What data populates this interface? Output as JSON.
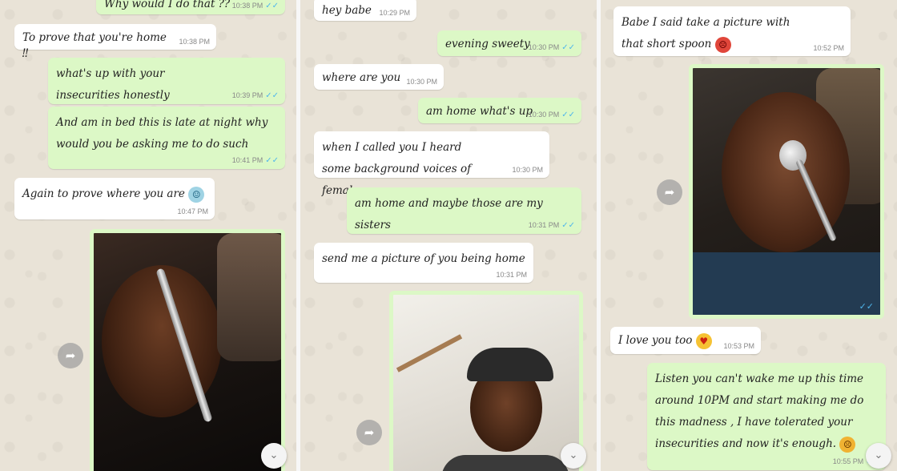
{
  "panels": [
    {
      "messages": [
        {
          "dir": "out",
          "text": "Why would I do that ??",
          "time": "10:38 PM",
          "ticks": "✓✓"
        },
        {
          "dir": "in",
          "text": "To prove that you're home ‼",
          "time": "10:38 PM"
        },
        {
          "dir": "out",
          "text": "what's up with your insecurities honestly",
          "time": "10:39 PM",
          "ticks": "✓✓"
        },
        {
          "dir": "out",
          "text": "And am in bed this is late at night why would you be asking me to do such",
          "time": "10:41 PM",
          "ticks": "✓✓"
        },
        {
          "dir": "in",
          "text": "Again to prove where you are",
          "time": "10:47 PM",
          "emoji": "shrug"
        }
      ]
    },
    {
      "messages": [
        {
          "dir": "in",
          "text": "hey babe",
          "time": "10:29 PM"
        },
        {
          "dir": "out",
          "text": "evening sweety",
          "time": "10:30 PM",
          "ticks": "✓✓"
        },
        {
          "dir": "in",
          "text": "where are you",
          "time": "10:30 PM"
        },
        {
          "dir": "out",
          "text": "am home what's up",
          "time": "10:30 PM",
          "ticks": "✓✓"
        },
        {
          "dir": "in",
          "text": "when I called you I heard some background voices of females",
          "time": "10:30 PM"
        },
        {
          "dir": "out",
          "text": "am home and maybe those are my sisters",
          "time": "10:31 PM",
          "ticks": "✓✓"
        },
        {
          "dir": "in",
          "text": "send me a picture of you being home",
          "time": "10:31 PM"
        }
      ]
    },
    {
      "messages": [
        {
          "dir": "in",
          "text": "Babe I said take a picture with that short spoon",
          "time": "10:52 PM",
          "emoji": "angry"
        },
        {
          "dir": "in",
          "text": "I love you too",
          "time": "10:53 PM",
          "emoji": "heart"
        },
        {
          "dir": "out",
          "text": "Listen you can't wake me up this time around 10PM and start making me do this madness , I have tolerated your insecurities and now it's enough.",
          "time": "10:55 PM",
          "ticks": "✓✓",
          "emoji": "frown"
        }
      ],
      "photo_ticks": "✓✓"
    }
  ],
  "icons": {
    "share": "share-arrow-icon",
    "scroll": "chevron-double-down-icon"
  },
  "colors": {
    "incoming": "#ffffff",
    "outgoing": "#dcf8c6",
    "tick": "#4fb6ec",
    "wallpaper": "#e9e3d7"
  }
}
